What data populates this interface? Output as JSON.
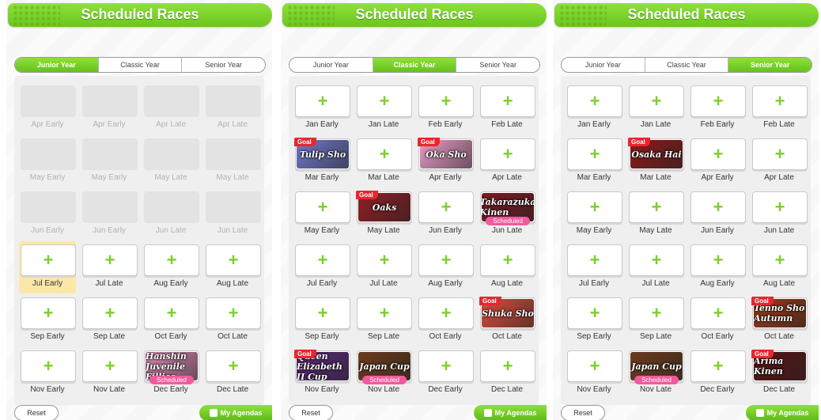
{
  "title": "Scheduled Races",
  "tabs": [
    "Junior Year",
    "Classic Year",
    "Senior Year"
  ],
  "reset_label": "Reset",
  "agendas_label": "My Agendas",
  "goal_label": "Goal",
  "scheduled_label": "Scheduled",
  "plus_icon": "+",
  "panels": [
    {
      "active_tab": 0,
      "cells": [
        {
          "label": "Apr Early",
          "state": "disabled"
        },
        {
          "label": "Apr Early",
          "state": "disabled"
        },
        {
          "label": "Apr Late",
          "state": "disabled"
        },
        {
          "label": "Apr Late",
          "state": "disabled"
        },
        {
          "label": "May Early",
          "state": "disabled"
        },
        {
          "label": "May Early",
          "state": "disabled"
        },
        {
          "label": "May Late",
          "state": "disabled"
        },
        {
          "label": "May Late",
          "state": "disabled"
        },
        {
          "label": "Jun Early",
          "state": "disabled"
        },
        {
          "label": "Jun Early",
          "state": "disabled"
        },
        {
          "label": "Jun Late",
          "state": "disabled"
        },
        {
          "label": "Jun Late",
          "state": "disabled"
        },
        {
          "label": "Jul Early",
          "state": "empty",
          "highlight": true
        },
        {
          "label": "Jul Late",
          "state": "empty"
        },
        {
          "label": "Aug Early",
          "state": "empty"
        },
        {
          "label": "Aug Late",
          "state": "empty"
        },
        {
          "label": "Sep Early",
          "state": "empty"
        },
        {
          "label": "Sep Late",
          "state": "empty"
        },
        {
          "label": "Oct Early",
          "state": "empty"
        },
        {
          "label": "Oct Late",
          "state": "empty"
        },
        {
          "label": "Nov Early",
          "state": "empty"
        },
        {
          "label": "Nov Late",
          "state": "empty"
        },
        {
          "label": "Dec Early",
          "state": "race",
          "race": "Hanshin Juvenile Fillies",
          "color": "#d98bb3",
          "scheduled": true
        },
        {
          "label": "Dec Late",
          "state": "empty"
        }
      ]
    },
    {
      "active_tab": 1,
      "cells": [
        {
          "label": "Jan Early",
          "state": "empty"
        },
        {
          "label": "Jan Late",
          "state": "empty"
        },
        {
          "label": "Feb Early",
          "state": "empty"
        },
        {
          "label": "Feb Late",
          "state": "empty"
        },
        {
          "label": "Mar Early",
          "state": "race",
          "race": "Tulip Sho",
          "color": "#6f78c8",
          "goal": true
        },
        {
          "label": "Mar Late",
          "state": "empty"
        },
        {
          "label": "Apr Early",
          "state": "race",
          "race": "Oka Sho",
          "color": "#e79ac5",
          "goal": true
        },
        {
          "label": "Apr Late",
          "state": "empty"
        },
        {
          "label": "May Early",
          "state": "empty"
        },
        {
          "label": "May Late",
          "state": "race",
          "race": "Oaks",
          "color": "#8c1f24",
          "goal": true
        },
        {
          "label": "Jun Early",
          "state": "empty"
        },
        {
          "label": "Jun Late",
          "state": "race",
          "race": "Takarazuka Kinen",
          "color": "#7a1a22",
          "scheduled": true
        },
        {
          "label": "Jul Early",
          "state": "empty"
        },
        {
          "label": "Jul Late",
          "state": "empty"
        },
        {
          "label": "Aug Early",
          "state": "empty"
        },
        {
          "label": "Aug Late",
          "state": "empty"
        },
        {
          "label": "Sep Early",
          "state": "empty"
        },
        {
          "label": "Sep Late",
          "state": "empty"
        },
        {
          "label": "Oct Early",
          "state": "empty"
        },
        {
          "label": "Oct Late",
          "state": "race",
          "race": "Shuka Sho",
          "color": "#d64c3a",
          "goal": true
        },
        {
          "label": "Nov Early",
          "state": "race",
          "race": "Queen Elizabeth II Cup",
          "color": "#5b2a7a",
          "goal": true
        },
        {
          "label": "Nov Late",
          "state": "race",
          "race": "Japan Cup",
          "color": "#6b3b1e",
          "scheduled": true
        },
        {
          "label": "Dec Early",
          "state": "empty"
        },
        {
          "label": "Dec Late",
          "state": "empty"
        }
      ]
    },
    {
      "active_tab": 2,
      "cells": [
        {
          "label": "Jan Early",
          "state": "empty"
        },
        {
          "label": "Jan Late",
          "state": "empty"
        },
        {
          "label": "Feb Early",
          "state": "empty"
        },
        {
          "label": "Feb Late",
          "state": "empty"
        },
        {
          "label": "Mar Early",
          "state": "empty"
        },
        {
          "label": "Mar Late",
          "state": "race",
          "race": "Osaka Hai",
          "color": "#8a1b1b",
          "goal": true
        },
        {
          "label": "Apr Early",
          "state": "empty"
        },
        {
          "label": "Apr Late",
          "state": "empty"
        },
        {
          "label": "May Early",
          "state": "empty"
        },
        {
          "label": "May Late",
          "state": "empty"
        },
        {
          "label": "Jun Early",
          "state": "empty"
        },
        {
          "label": "Jun Late",
          "state": "empty"
        },
        {
          "label": "Jul Early",
          "state": "empty"
        },
        {
          "label": "Jul Late",
          "state": "empty"
        },
        {
          "label": "Aug Early",
          "state": "empty"
        },
        {
          "label": "Aug Late",
          "state": "empty"
        },
        {
          "label": "Sep Early",
          "state": "empty"
        },
        {
          "label": "Sep Late",
          "state": "empty"
        },
        {
          "label": "Oct Early",
          "state": "empty"
        },
        {
          "label": "Oct Late",
          "state": "race",
          "race": "Tenno Sho Autumn",
          "color": "#9a3a1a",
          "goal": true
        },
        {
          "label": "Nov Early",
          "state": "empty"
        },
        {
          "label": "Nov Late",
          "state": "race",
          "race": "Japan Cup",
          "color": "#6b3b1e",
          "scheduled": true
        },
        {
          "label": "Dec Early",
          "state": "empty"
        },
        {
          "label": "Dec Late",
          "state": "race",
          "race": "Arima Kinen",
          "color": "#5a1414",
          "goal": true
        }
      ]
    }
  ]
}
